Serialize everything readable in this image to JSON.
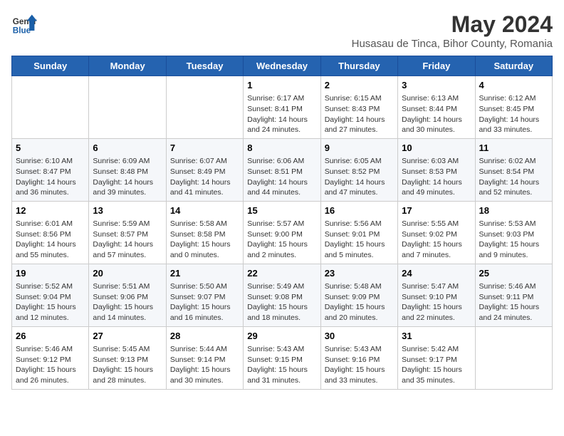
{
  "header": {
    "logo_line1": "General",
    "logo_line2": "Blue",
    "month_year": "May 2024",
    "location": "Husasau de Tinca, Bihor County, Romania"
  },
  "days": [
    "Sunday",
    "Monday",
    "Tuesday",
    "Wednesday",
    "Thursday",
    "Friday",
    "Saturday"
  ],
  "weeks": [
    [
      {
        "date": "",
        "info": ""
      },
      {
        "date": "",
        "info": ""
      },
      {
        "date": "",
        "info": ""
      },
      {
        "date": "1",
        "info": "Sunrise: 6:17 AM\nSunset: 8:41 PM\nDaylight: 14 hours and 24 minutes."
      },
      {
        "date": "2",
        "info": "Sunrise: 6:15 AM\nSunset: 8:43 PM\nDaylight: 14 hours and 27 minutes."
      },
      {
        "date": "3",
        "info": "Sunrise: 6:13 AM\nSunset: 8:44 PM\nDaylight: 14 hours and 30 minutes."
      },
      {
        "date": "4",
        "info": "Sunrise: 6:12 AM\nSunset: 8:45 PM\nDaylight: 14 hours and 33 minutes."
      }
    ],
    [
      {
        "date": "5",
        "info": "Sunrise: 6:10 AM\nSunset: 8:47 PM\nDaylight: 14 hours and 36 minutes."
      },
      {
        "date": "6",
        "info": "Sunrise: 6:09 AM\nSunset: 8:48 PM\nDaylight: 14 hours and 39 minutes."
      },
      {
        "date": "7",
        "info": "Sunrise: 6:07 AM\nSunset: 8:49 PM\nDaylight: 14 hours and 41 minutes."
      },
      {
        "date": "8",
        "info": "Sunrise: 6:06 AM\nSunset: 8:51 PM\nDaylight: 14 hours and 44 minutes."
      },
      {
        "date": "9",
        "info": "Sunrise: 6:05 AM\nSunset: 8:52 PM\nDaylight: 14 hours and 47 minutes."
      },
      {
        "date": "10",
        "info": "Sunrise: 6:03 AM\nSunset: 8:53 PM\nDaylight: 14 hours and 49 minutes."
      },
      {
        "date": "11",
        "info": "Sunrise: 6:02 AM\nSunset: 8:54 PM\nDaylight: 14 hours and 52 minutes."
      }
    ],
    [
      {
        "date": "12",
        "info": "Sunrise: 6:01 AM\nSunset: 8:56 PM\nDaylight: 14 hours and 55 minutes."
      },
      {
        "date": "13",
        "info": "Sunrise: 5:59 AM\nSunset: 8:57 PM\nDaylight: 14 hours and 57 minutes."
      },
      {
        "date": "14",
        "info": "Sunrise: 5:58 AM\nSunset: 8:58 PM\nDaylight: 15 hours and 0 minutes."
      },
      {
        "date": "15",
        "info": "Sunrise: 5:57 AM\nSunset: 9:00 PM\nDaylight: 15 hours and 2 minutes."
      },
      {
        "date": "16",
        "info": "Sunrise: 5:56 AM\nSunset: 9:01 PM\nDaylight: 15 hours and 5 minutes."
      },
      {
        "date": "17",
        "info": "Sunrise: 5:55 AM\nSunset: 9:02 PM\nDaylight: 15 hours and 7 minutes."
      },
      {
        "date": "18",
        "info": "Sunrise: 5:53 AM\nSunset: 9:03 PM\nDaylight: 15 hours and 9 minutes."
      }
    ],
    [
      {
        "date": "19",
        "info": "Sunrise: 5:52 AM\nSunset: 9:04 PM\nDaylight: 15 hours and 12 minutes."
      },
      {
        "date": "20",
        "info": "Sunrise: 5:51 AM\nSunset: 9:06 PM\nDaylight: 15 hours and 14 minutes."
      },
      {
        "date": "21",
        "info": "Sunrise: 5:50 AM\nSunset: 9:07 PM\nDaylight: 15 hours and 16 minutes."
      },
      {
        "date": "22",
        "info": "Sunrise: 5:49 AM\nSunset: 9:08 PM\nDaylight: 15 hours and 18 minutes."
      },
      {
        "date": "23",
        "info": "Sunrise: 5:48 AM\nSunset: 9:09 PM\nDaylight: 15 hours and 20 minutes."
      },
      {
        "date": "24",
        "info": "Sunrise: 5:47 AM\nSunset: 9:10 PM\nDaylight: 15 hours and 22 minutes."
      },
      {
        "date": "25",
        "info": "Sunrise: 5:46 AM\nSunset: 9:11 PM\nDaylight: 15 hours and 24 minutes."
      }
    ],
    [
      {
        "date": "26",
        "info": "Sunrise: 5:46 AM\nSunset: 9:12 PM\nDaylight: 15 hours and 26 minutes."
      },
      {
        "date": "27",
        "info": "Sunrise: 5:45 AM\nSunset: 9:13 PM\nDaylight: 15 hours and 28 minutes."
      },
      {
        "date": "28",
        "info": "Sunrise: 5:44 AM\nSunset: 9:14 PM\nDaylight: 15 hours and 30 minutes."
      },
      {
        "date": "29",
        "info": "Sunrise: 5:43 AM\nSunset: 9:15 PM\nDaylight: 15 hours and 31 minutes."
      },
      {
        "date": "30",
        "info": "Sunrise: 5:43 AM\nSunset: 9:16 PM\nDaylight: 15 hours and 33 minutes."
      },
      {
        "date": "31",
        "info": "Sunrise: 5:42 AM\nSunset: 9:17 PM\nDaylight: 15 hours and 35 minutes."
      },
      {
        "date": "",
        "info": ""
      }
    ]
  ]
}
